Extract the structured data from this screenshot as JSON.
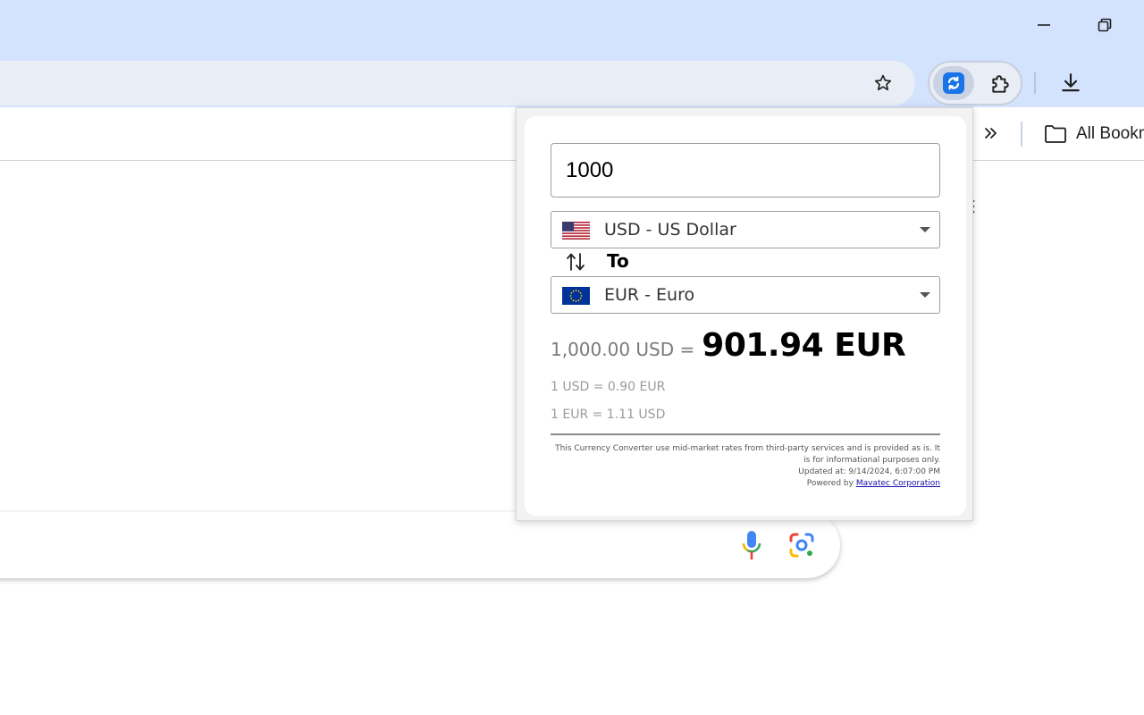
{
  "window": {
    "minimize_icon": "minimize-icon",
    "restore_icon": "restore-icon"
  },
  "toolbar": {
    "bookmark_star_icon": "star-icon",
    "extension_pinned_icon": "currency-converter-icon",
    "extensions_icon": "puzzle-icon",
    "download_icon": "download-icon"
  },
  "bookmarks_bar": {
    "overflow_icon": "double-chevron-icon",
    "all_bookmarks_label": "All Bookm"
  },
  "converter": {
    "amount_value": "1000",
    "from_currency": {
      "label": "USD - US Dollar",
      "flag": "us-flag"
    },
    "to_label": "To",
    "to_currency": {
      "label": "EUR - Euro",
      "flag": "eu-flag"
    },
    "result_from": "1,000.00 USD =",
    "result_to": "901.94 EUR",
    "rate_line_1": "1 USD = 0.90 EUR",
    "rate_line_2": "1 EUR = 1.11 USD",
    "disclaimer_line_1": "This Currency Converter use mid-market rates from third-party services and is provided as is. It",
    "disclaimer_line_2": "is for informational purposes only.",
    "updated_at": "Updated at: 9/14/2024, 6:07:00 PM",
    "powered_by_prefix": "Powered by",
    "powered_by_link": "Mavatec Corporation"
  },
  "colors": {
    "chrome_frame": "#d3e3fd",
    "omnibox": "#e9eef6",
    "result_accent": "#000000"
  }
}
